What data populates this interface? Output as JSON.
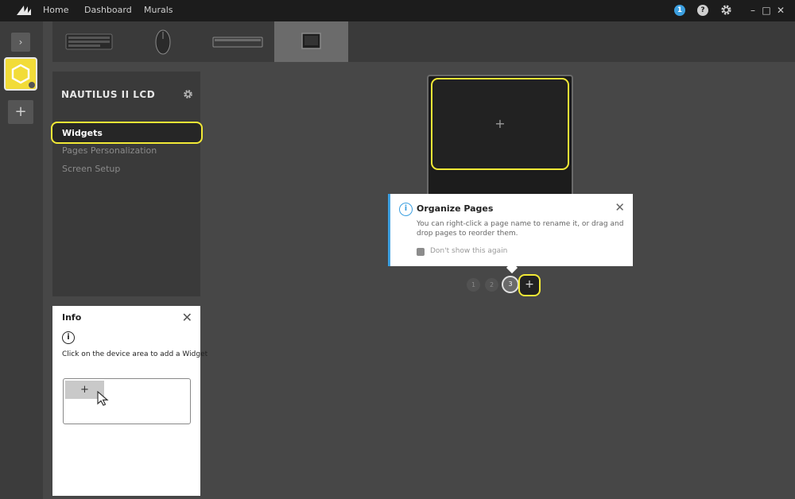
{
  "titlebar": {
    "nav": [
      "Home",
      "Dashboard",
      "Murals"
    ],
    "badge_count": "1",
    "help_label": "?",
    "window": {
      "minimize": "–",
      "maximize": "□",
      "close": "✕"
    }
  },
  "rail": {
    "expand_label": "›",
    "add_label": "+"
  },
  "devices": {
    "tabs": [
      "keyboard",
      "mouse",
      "memory",
      "lcd-screen"
    ],
    "active": "lcd-screen"
  },
  "panel": {
    "title": "NAUTILUS II LCD",
    "items": [
      "Widgets",
      "Pages Personalization",
      "Screen Setup"
    ],
    "active_item": "Widgets"
  },
  "info_card": {
    "title": "Info",
    "icon_label": "i",
    "text": "Click on the device area to add a Widget",
    "illustration_plus": "+"
  },
  "preview": {
    "screen_plus": "+"
  },
  "tooltip": {
    "icon_label": "i",
    "title": "Organize Pages",
    "body": "You can right-click a page name to rename it, or drag and drop pages to reorder them.",
    "checkbox_label": "Don't show this again",
    "close": "✕"
  },
  "pages": {
    "items": [
      "1",
      "2",
      "3"
    ],
    "active": "3",
    "add_label": "+"
  },
  "colors": {
    "accent_yellow": "#f2e936",
    "info_blue": "#3b9fe0",
    "background": "#474747"
  }
}
